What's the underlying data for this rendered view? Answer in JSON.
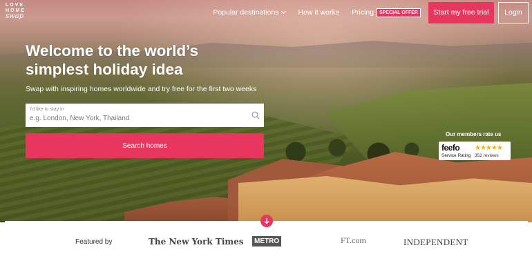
{
  "logo": {
    "line1": "LOVE",
    "line2": "HOME",
    "line3": "swap"
  },
  "nav": {
    "popular": "Popular destinations",
    "how": "How it works",
    "pricing": "Pricing",
    "special_offer": "SPECIAL OFFER",
    "trial": "Start my free trial",
    "login": "Login"
  },
  "hero": {
    "headline": "Welcome to the world’s simplest holiday idea",
    "subtext": "Swap with inspiring homes worldwide and try free for the first two weeks"
  },
  "search": {
    "label": "I'd like to stay in",
    "placeholder": "e.g. London, New York, Thailand",
    "button": "Search homes"
  },
  "rating": {
    "title": "Our members rate us",
    "brand": "feefo",
    "sub": "Service Rating",
    "stars": "★★★★★",
    "reviews": "352 reviews"
  },
  "featured": {
    "label": "Featured by",
    "publications": [
      "The New York Times",
      "METRO",
      "FT.com",
      "INDEPENDENT"
    ]
  },
  "colors": {
    "accent": "#e8365f"
  },
  "icons": {
    "search": "search-icon",
    "nav_chevron": "chevron-down-icon",
    "scroll": "arrow-down-icon"
  }
}
